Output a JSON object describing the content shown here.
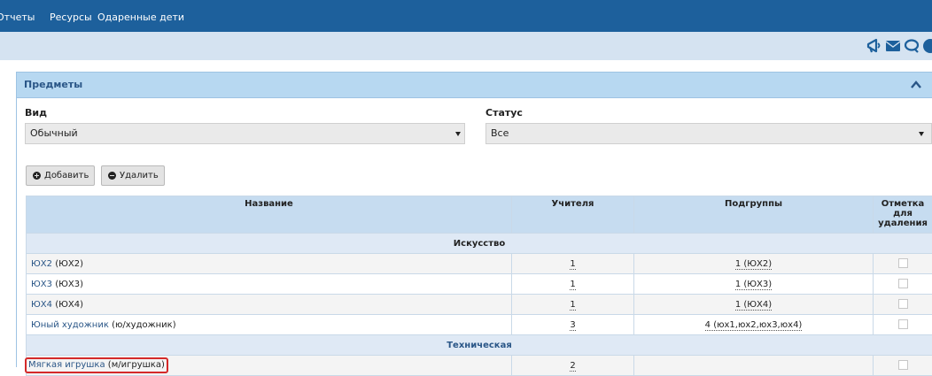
{
  "topnav": {
    "items": [
      "Отчеты",
      "Ресурсы",
      "Одаренные дети"
    ]
  },
  "toolbar_icons": [
    "megaphone-icon",
    "mail-icon",
    "chat-icon",
    "help-icon"
  ],
  "panel": {
    "title": "Предметы"
  },
  "filters": {
    "vid_label": "Вид",
    "vid_value": "Обычный",
    "status_label": "Статус",
    "status_value": "Все"
  },
  "buttons": {
    "add": "Добавить",
    "delete": "Удалить"
  },
  "table": {
    "headers": [
      "Название",
      "Учителя",
      "Подгруппы",
      "Отметка для удаления"
    ],
    "groups": [
      {
        "name": "Искусство",
        "rows": [
          {
            "link": "ЮХ2",
            "short": "(ЮХ2)",
            "teachers": "1",
            "subgroups": "1 (ЮХ2)"
          },
          {
            "link": "ЮХ3",
            "short": "(ЮХ3)",
            "teachers": "1",
            "subgroups": "1 (ЮХ3)"
          },
          {
            "link": "ЮХ4",
            "short": "(ЮХ4)",
            "teachers": "1",
            "subgroups": "1 (ЮХ4)"
          },
          {
            "link": "Юный художник",
            "short": "(ю/художник)",
            "teachers": "3",
            "subgroups": "4 (юх1,юх2,юх3,юх4)"
          }
        ]
      },
      {
        "name": "Техническая",
        "rows": [
          {
            "link": "Мягкая игрушка",
            "short": "(м/игрушка)",
            "teachers": "2",
            "subgroups": ""
          }
        ]
      }
    ]
  },
  "colors": {
    "topbar": "#1d609c",
    "subbar": "#d5e3f1",
    "panel_header": "#b7d8f1",
    "link": "#2a5687",
    "highlight": "#d42a2a"
  }
}
